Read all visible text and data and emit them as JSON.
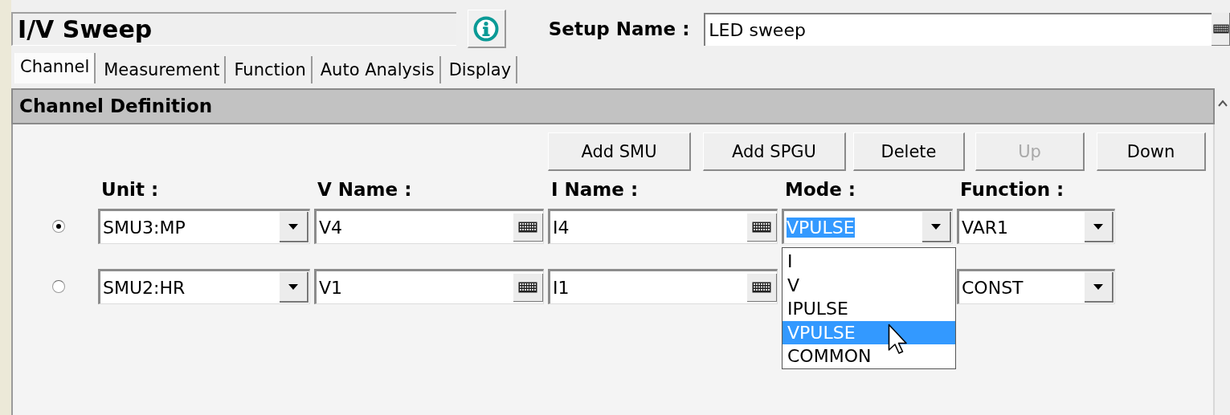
{
  "header": {
    "title": "I/V Sweep",
    "setup_label": "Setup Name :",
    "setup_name": "LED sweep"
  },
  "tabs": [
    {
      "label": "Channel",
      "selected": true
    },
    {
      "label": "Measurement",
      "selected": false
    },
    {
      "label": "Function",
      "selected": false
    },
    {
      "label": "Auto Analysis",
      "selected": false
    },
    {
      "label": "Display",
      "selected": false
    }
  ],
  "section_title": "Channel Definition",
  "buttons": [
    {
      "label": "Add SMU",
      "disabled": false
    },
    {
      "label": "Add SPGU",
      "disabled": false
    },
    {
      "label": "Delete",
      "disabled": false
    },
    {
      "label": "Up",
      "disabled": true
    },
    {
      "label": "Down",
      "disabled": false
    }
  ],
  "columns": [
    "Unit :",
    "V Name :",
    "I Name :",
    "Mode :",
    "Function :"
  ],
  "channels": [
    {
      "selected": true,
      "unit": "SMU3:MP",
      "v_name": "V4",
      "i_name": "I4",
      "mode": "VPULSE",
      "mode_highlighted": true,
      "function": "VAR1"
    },
    {
      "selected": false,
      "unit": "SMU2:HR",
      "v_name": "V1",
      "i_name": "I1",
      "function": "CONST"
    }
  ],
  "mode_dropdown": {
    "options": [
      {
        "label": "I",
        "selected": false
      },
      {
        "label": "V",
        "selected": false
      },
      {
        "label": "IPULSE",
        "selected": false
      },
      {
        "label": "VPULSE",
        "selected": true
      },
      {
        "label": "COMMON",
        "selected": false
      }
    ]
  }
}
